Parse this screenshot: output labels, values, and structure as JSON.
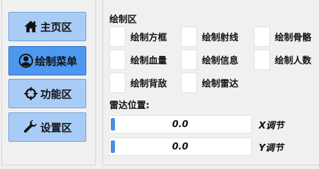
{
  "sidebar": {
    "items": [
      {
        "label": "主页区",
        "icon": "home-icon",
        "active": false
      },
      {
        "label": "绘制菜单",
        "icon": "user-icon",
        "active": true
      },
      {
        "label": "功能区",
        "icon": "crosshair-icon",
        "active": false
      },
      {
        "label": "设置区",
        "icon": "wrench-icon",
        "active": false
      }
    ]
  },
  "draw": {
    "title": "绘制区",
    "options": [
      {
        "label": "绘制方框",
        "checked": false
      },
      {
        "label": "绘制射线",
        "checked": false
      },
      {
        "label": "绘制骨骼",
        "checked": false
      },
      {
        "label": "绘制血量",
        "checked": false
      },
      {
        "label": "绘制信息",
        "checked": false
      },
      {
        "label": "绘制人数",
        "checked": false
      },
      {
        "label": "绘制背敌",
        "checked": false
      },
      {
        "label": "绘制雷达",
        "checked": false
      }
    ]
  },
  "radar": {
    "title": "雷达位置:",
    "x_slider": {
      "value": "0.0",
      "label": "X调节"
    },
    "y_slider": {
      "value": "0.0",
      "label": "Y调节"
    }
  },
  "colors": {
    "active": "#4e98f0",
    "inactive": "#a9ccf6",
    "slider_fill": "#4a90e2"
  }
}
